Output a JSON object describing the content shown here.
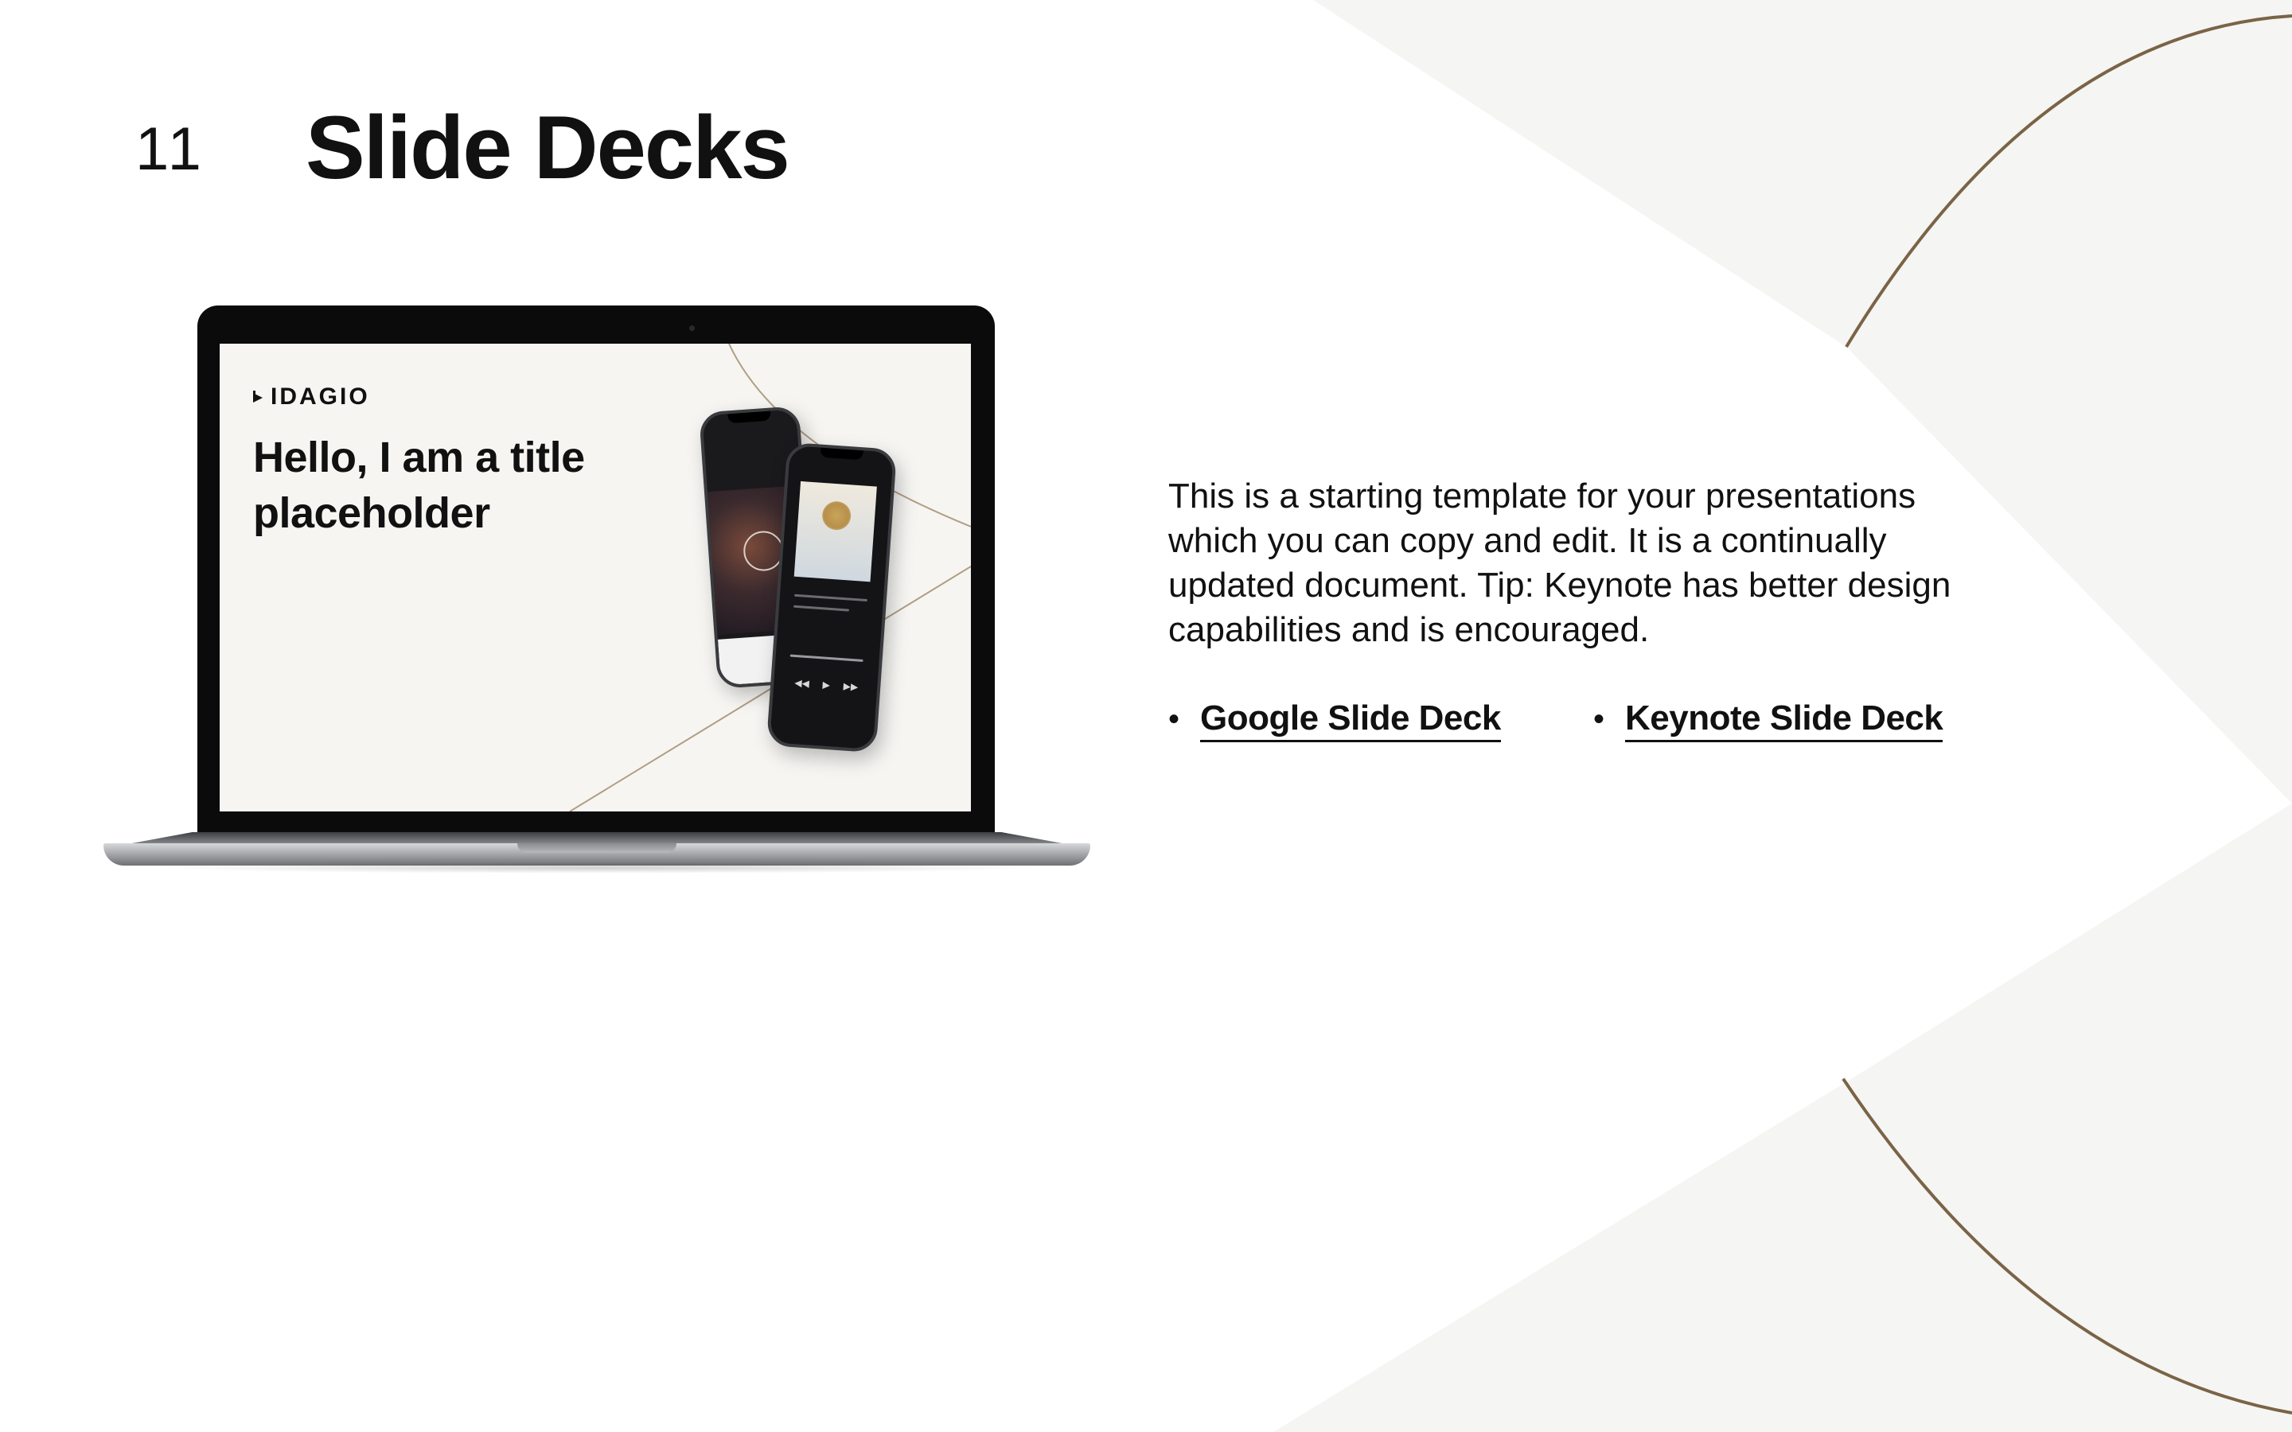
{
  "page": {
    "number": "11",
    "title": "Slide Decks"
  },
  "colors": {
    "background": "#ffffff",
    "background_shape": "#f5f5f3",
    "accent_line": "#7a6446",
    "text": "#111111"
  },
  "laptop_screen": {
    "logo_text": "IDAGIO",
    "logo_icon": "play-triangle-icon",
    "title": "Hello, I am a title placeholder"
  },
  "description": "This is a starting template for your presentations which you can copy and edit. It is a continually updated document. Tip: Keynote has better design capabilities and is encouraged.",
  "links": [
    {
      "bullet": "•",
      "label": "Google Slide Deck"
    },
    {
      "bullet": "•",
      "label": "Keynote Slide Deck"
    }
  ]
}
